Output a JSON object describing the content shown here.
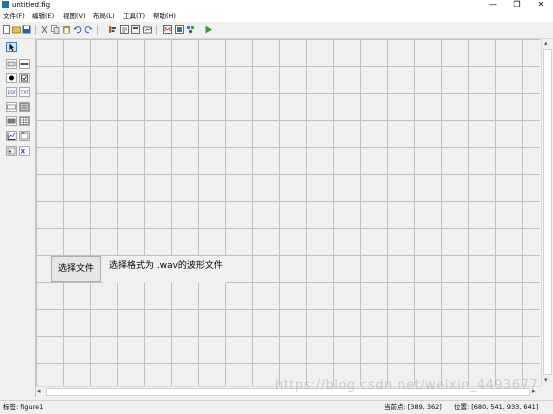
{
  "window": {
    "title": "untitled.fig",
    "controls": [
      "—",
      "❐",
      "✕"
    ]
  },
  "menu": [
    "文件(F)",
    "编辑(E)",
    "视图(V)",
    "布局(L)",
    "工具(T)",
    "帮助(H)"
  ],
  "toolbar": {
    "icons": [
      "new-icon",
      "open-icon",
      "save-icon",
      "cut-icon",
      "copy-icon",
      "paste-icon",
      "undo-icon",
      "redo-icon",
      "align-icon",
      "menu-editor-icon",
      "tab-order-icon",
      "toolbar-editor-icon",
      "m-file-editor-icon",
      "property-inspector-icon",
      "object-browser-icon",
      "run-icon"
    ]
  },
  "palette": {
    "tools": [
      "select-tool-icon",
      "pushbutton-tool-icon",
      "slider-tool-icon",
      "radio-button-tool-icon",
      "checkbox-tool-icon",
      "edit-text-tool-icon",
      "static-text-tool-icon",
      "popup-menu-tool-icon",
      "listbox-tool-icon",
      "toggle-button-tool-icon",
      "table-tool-icon",
      "axes-tool-icon",
      "panel-tool-icon",
      "button-group-tool-icon",
      "activex-tool-icon"
    ],
    "selected": "select-tool-icon"
  },
  "canvas": {
    "button_label": "选择文件",
    "text_label": "选择格式为 .wav的波形文件"
  },
  "status": {
    "tag": "标签: figure1",
    "current_point": "当前点:  [389, 362]",
    "position": "位置: [680, 541, 933, 641]"
  },
  "watermark": "https://blog.csdn.net/weixin_4493677"
}
